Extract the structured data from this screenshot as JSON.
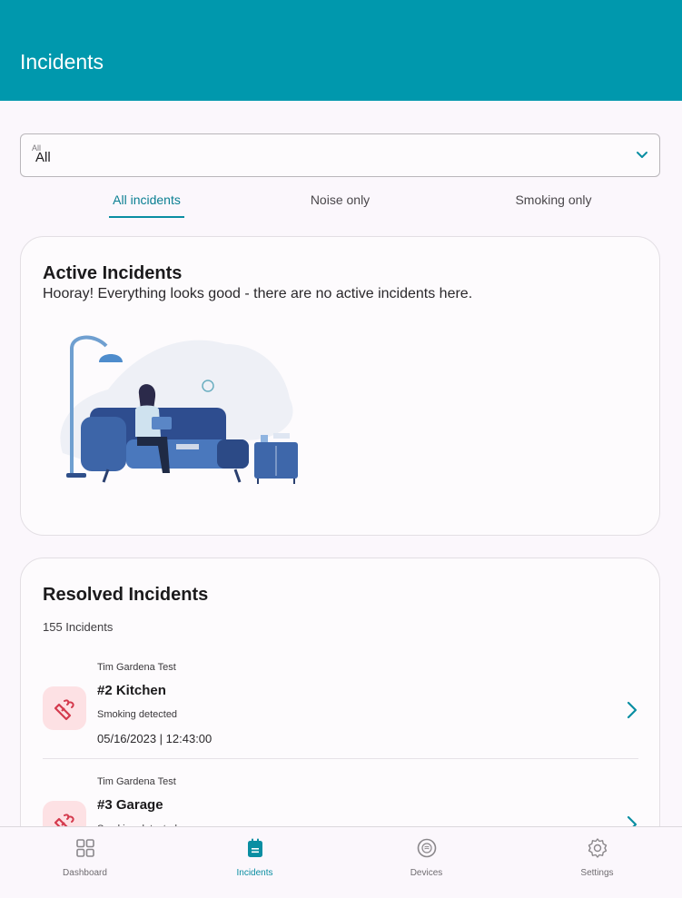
{
  "app_bar": {
    "title": "Incidents"
  },
  "filter": {
    "label": "All",
    "value": "All"
  },
  "tabs": [
    {
      "label": "All incidents",
      "active": true
    },
    {
      "label": "Noise only",
      "active": false
    },
    {
      "label": "Smoking only",
      "active": false
    }
  ],
  "active_card": {
    "title": "Active Incidents",
    "message": "Hooray! Everything looks good - there are no active incidents here."
  },
  "resolved_card": {
    "title": "Resolved Incidents",
    "count": "155 Incidents",
    "items": [
      {
        "org": "Tim Gardena Test",
        "name": "#2 Kitchen",
        "status": "Smoking detected",
        "date": "05/16/2023 | 12:43:00",
        "icon": "smoking-icon"
      },
      {
        "org": "Tim Gardena Test",
        "name": "#3 Garage",
        "status": "Smoking detected",
        "date": "",
        "icon": "smoking-icon"
      }
    ]
  },
  "bottom_nav": [
    {
      "label": "Dashboard",
      "icon": "grid-icon",
      "active": false
    },
    {
      "label": "Incidents",
      "icon": "clipboard-icon",
      "active": true
    },
    {
      "label": "Devices",
      "icon": "sensor-icon",
      "active": false
    },
    {
      "label": "Settings",
      "icon": "gear-icon",
      "active": false
    }
  ],
  "colors": {
    "primary": "#0098ad",
    "accent": "#0a8ea2",
    "smoking_bg": "#fde1e4",
    "smoking_icon": "#d43a4d"
  }
}
